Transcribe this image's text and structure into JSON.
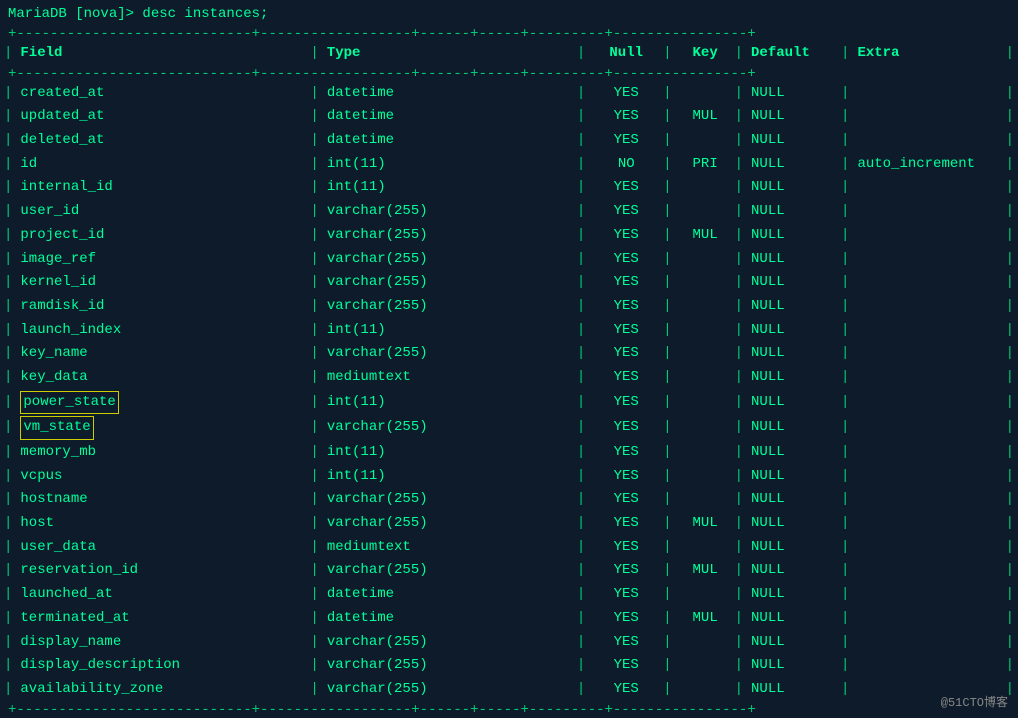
{
  "terminal": {
    "command": "MariaDB [nova]> desc instances;",
    "separator_top": "+---------------------------+------------------+------+-----+---------+----------------+",
    "separator_mid": "+---------------------------+------------------+------+-----+---------+----------------+",
    "separator_bot": "+---------------------------+------------------+------+-----+---------+----------------+",
    "columns": {
      "field": "Field",
      "type": "Type",
      "null": "Null",
      "key": "Key",
      "default": "Default",
      "extra": "Extra"
    },
    "rows": [
      {
        "field": "created_at",
        "type": "datetime",
        "null": "YES",
        "key": "",
        "default": "NULL",
        "extra": "",
        "highlight": false
      },
      {
        "field": "updated_at",
        "type": "datetime",
        "null": "YES",
        "key": "MUL",
        "default": "NULL",
        "extra": "",
        "highlight": false
      },
      {
        "field": "deleted_at",
        "type": "datetime",
        "null": "YES",
        "key": "",
        "default": "NULL",
        "extra": "",
        "highlight": false
      },
      {
        "field": "id",
        "type": "int(11)",
        "null": "NO",
        "key": "PRI",
        "default": "NULL",
        "extra": "auto_increment",
        "highlight": false
      },
      {
        "field": "internal_id",
        "type": "int(11)",
        "null": "YES",
        "key": "",
        "default": "NULL",
        "extra": "",
        "highlight": false
      },
      {
        "field": "user_id",
        "type": "varchar(255)",
        "null": "YES",
        "key": "",
        "default": "NULL",
        "extra": "",
        "highlight": false
      },
      {
        "field": "project_id",
        "type": "varchar(255)",
        "null": "YES",
        "key": "MUL",
        "default": "NULL",
        "extra": "",
        "highlight": false
      },
      {
        "field": "image_ref",
        "type": "varchar(255)",
        "null": "YES",
        "key": "",
        "default": "NULL",
        "extra": "",
        "highlight": false
      },
      {
        "field": "kernel_id",
        "type": "varchar(255)",
        "null": "YES",
        "key": "",
        "default": "NULL",
        "extra": "",
        "highlight": false
      },
      {
        "field": "ramdisk_id",
        "type": "varchar(255)",
        "null": "YES",
        "key": "",
        "default": "NULL",
        "extra": "",
        "highlight": false
      },
      {
        "field": "launch_index",
        "type": "int(11)",
        "null": "YES",
        "key": "",
        "default": "NULL",
        "extra": "",
        "highlight": false
      },
      {
        "field": "key_name",
        "type": "varchar(255)",
        "null": "YES",
        "key": "",
        "default": "NULL",
        "extra": "",
        "highlight": false
      },
      {
        "field": "key_data",
        "type": "mediumtext",
        "null": "YES",
        "key": "",
        "default": "NULL",
        "extra": "",
        "highlight": false
      },
      {
        "field": "power_state",
        "type": "int(11)",
        "null": "YES",
        "key": "",
        "default": "NULL",
        "extra": "",
        "highlight": true
      },
      {
        "field": "vm_state",
        "type": "varchar(255)",
        "null": "YES",
        "key": "",
        "default": "NULL",
        "extra": "",
        "highlight": true
      },
      {
        "field": "memory_mb",
        "type": "int(11)",
        "null": "YES",
        "key": "",
        "default": "NULL",
        "extra": "",
        "highlight": false
      },
      {
        "field": "vcpus",
        "type": "int(11)",
        "null": "YES",
        "key": "",
        "default": "NULL",
        "extra": "",
        "highlight": false
      },
      {
        "field": "hostname",
        "type": "varchar(255)",
        "null": "YES",
        "key": "",
        "default": "NULL",
        "extra": "",
        "highlight": false
      },
      {
        "field": "host",
        "type": "varchar(255)",
        "null": "YES",
        "key": "MUL",
        "default": "NULL",
        "extra": "",
        "highlight": false
      },
      {
        "field": "user_data",
        "type": "mediumtext",
        "null": "YES",
        "key": "",
        "default": "NULL",
        "extra": "",
        "highlight": false
      },
      {
        "field": "reservation_id",
        "type": "varchar(255)",
        "null": "YES",
        "key": "MUL",
        "default": "NULL",
        "extra": "",
        "highlight": false
      },
      {
        "field": "launched_at",
        "type": "datetime",
        "null": "YES",
        "key": "",
        "default": "NULL",
        "extra": "",
        "highlight": false
      },
      {
        "field": "terminated_at",
        "type": "datetime",
        "null": "YES",
        "key": "MUL",
        "default": "NULL",
        "extra": "",
        "highlight": false
      },
      {
        "field": "display_name",
        "type": "varchar(255)",
        "null": "YES",
        "key": "",
        "default": "NULL",
        "extra": "",
        "highlight": false
      },
      {
        "field": "display_description",
        "type": "varchar(255)",
        "null": "YES",
        "key": "",
        "default": "NULL",
        "extra": "",
        "highlight": false
      },
      {
        "field": "availability_zone",
        "type": "varchar(255)",
        "null": "YES",
        "key": "",
        "default": "NULL",
        "extra": "",
        "highlight": false
      }
    ],
    "watermark": "@51CTO博客"
  }
}
